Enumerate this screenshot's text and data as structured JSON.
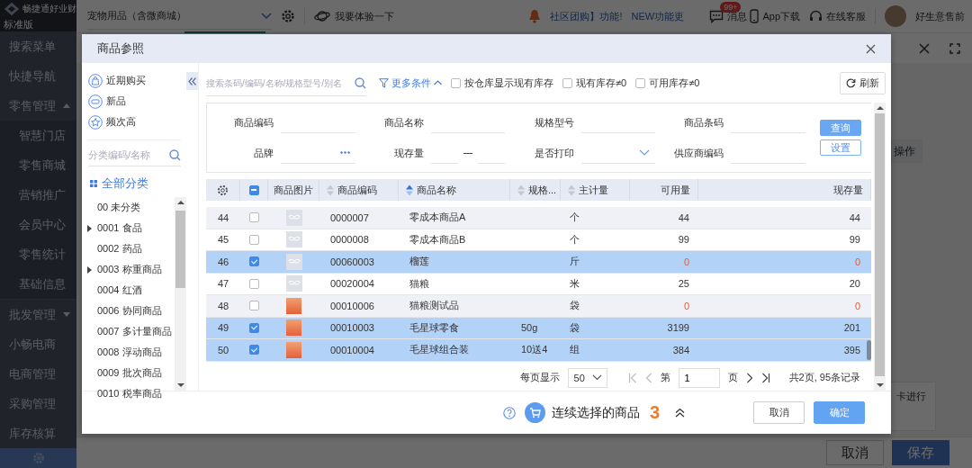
{
  "app": {
    "brand": "畅捷通好业财",
    "edition": "标准版",
    "store": "宠物用品（含微商城）",
    "try_link": "我要体验一下",
    "notices": [
      "社区团购】功能!",
      "NEW功能更"
    ],
    "messages": "消息",
    "message_badge": "99+",
    "app_download": "App下载",
    "support": "在线客服",
    "user": "好生意售前"
  },
  "sidebar": {
    "items": [
      {
        "label": "搜索菜单",
        "kind": "link"
      },
      {
        "label": "快捷导航",
        "kind": "link"
      },
      {
        "label": "零售管理",
        "kind": "group",
        "expanded": true,
        "children": [
          {
            "label": "智慧门店"
          },
          {
            "label": "零售商城"
          },
          {
            "label": "营销推广"
          },
          {
            "label": "会员中心"
          },
          {
            "label": "零售统计"
          },
          {
            "label": "基础信息"
          }
        ]
      },
      {
        "label": "批发管理",
        "kind": "group",
        "expanded": false
      },
      {
        "label": "小畅电商",
        "kind": "link"
      },
      {
        "label": "电商管理",
        "kind": "link"
      },
      {
        "label": "采购管理",
        "kind": "link"
      },
      {
        "label": "库存核算",
        "kind": "link"
      }
    ]
  },
  "page": {
    "action": "操作",
    "note": "卡进行",
    "buttons": [
      {
        "label": "取消",
        "kind": "secondary"
      },
      {
        "label": "保存",
        "kind": "primary"
      }
    ]
  },
  "dialog": {
    "title": "商品参照",
    "quick_filters": [
      {
        "label": "近期购买",
        "kind": "bag"
      },
      {
        "label": "新品",
        "kind": "new"
      },
      {
        "label": "频次高",
        "kind": "star"
      }
    ],
    "category_search": {
      "placeholder": "分类编码/名称"
    },
    "all_categories": "全部分类",
    "categories": [
      {
        "label": "00 未分类",
        "expandable": false
      },
      {
        "label": "0001 食品",
        "expandable": true
      },
      {
        "label": "0002 药品",
        "expandable": false
      },
      {
        "label": "0003 称重商品",
        "expandable": true
      },
      {
        "label": "0004 红酒",
        "expandable": false
      },
      {
        "label": "0006 协同商品",
        "expandable": false
      },
      {
        "label": "0007 多计量商品",
        "expandable": false
      },
      {
        "label": "0008 浮动商品",
        "expandable": false
      },
      {
        "label": "0009 批次商品",
        "expandable": false
      },
      {
        "label": "0010 税率商品",
        "expandable": false
      }
    ],
    "search": {
      "placeholder": "搜索条码/编码/名称/规格型号/别名"
    },
    "more_conditions": "更多条件",
    "options": [
      {
        "label": "按仓库显示现有库存",
        "checked": false
      },
      {
        "label": "现有库存≠0",
        "checked": false
      },
      {
        "label": "可用库存≠0",
        "checked": false
      }
    ],
    "refresh": "刷新",
    "filters": [
      {
        "label": "商品编码",
        "kind": "text"
      },
      {
        "label": "商品名称",
        "kind": "text"
      },
      {
        "label": "规格型号",
        "kind": "text"
      },
      {
        "label": "商品条码",
        "kind": "text"
      },
      {
        "label": "品牌",
        "kind": "picker"
      },
      {
        "label": "现存量",
        "kind": "range"
      },
      {
        "label": "是否打印",
        "kind": "select"
      },
      {
        "label": "供应商编码",
        "kind": "text"
      }
    ],
    "query": "查询",
    "settings": "设置",
    "partially_selected": true,
    "columns": [
      {
        "label": "商品图片",
        "kind": "plain"
      },
      {
        "label": "商品编码",
        "kind": "sortable",
        "sorted": false
      },
      {
        "label": "商品名称",
        "kind": "sortable",
        "sorted": true
      },
      {
        "label": "规格...",
        "kind": "sortable",
        "sorted": false
      },
      {
        "label": "主计量",
        "kind": "sortable",
        "sorted": false
      },
      {
        "label": "可用量",
        "kind": "plain"
      },
      {
        "label": "现存量",
        "kind": "plain"
      }
    ],
    "rows": [
      {
        "no": "44",
        "selected": false,
        "kind": "placeholder",
        "code": "0000007",
        "name": "零成本商品A",
        "spec": "",
        "unit": "个",
        "available": "44",
        "stock": "44",
        "alert": false
      },
      {
        "no": "45",
        "selected": false,
        "kind": "placeholder",
        "code": "0000008",
        "name": "零成本商品B",
        "spec": "",
        "unit": "个",
        "available": "99",
        "stock": "99",
        "alert": false
      },
      {
        "no": "46",
        "selected": true,
        "kind": "placeholder",
        "code": "00060003",
        "name": "榴莲",
        "spec": "",
        "unit": "斤",
        "available": "0",
        "stock": "0",
        "alert": true
      },
      {
        "no": "47",
        "selected": false,
        "kind": "placeholder",
        "code": "00020004",
        "name": "猫粮",
        "spec": "",
        "unit": "米",
        "available": "25",
        "stock": "20",
        "alert": false
      },
      {
        "no": "48",
        "selected": false,
        "kind": "photo",
        "code": "00010006",
        "name": "猫粮测试品",
        "spec": "",
        "unit": "袋",
        "available": "0",
        "stock": "0",
        "alert": true
      },
      {
        "no": "49",
        "selected": true,
        "kind": "photo",
        "code": "00010003",
        "name": "毛星球零食",
        "spec": "50g",
        "unit": "袋",
        "available": "3199",
        "stock": "201",
        "alert": false
      },
      {
        "no": "50",
        "selected": true,
        "kind": "photo",
        "code": "00010004",
        "name": "毛星球组合装",
        "spec": "10送4",
        "unit": "组",
        "available": "384",
        "stock": "395",
        "alert": false
      }
    ],
    "pagination": {
      "per_page_label": "每页显示",
      "per_page": "50",
      "page_prefix": "第",
      "page": "1",
      "page_suffix": "页",
      "total": "共2页, 95条记录"
    },
    "selection_label": "连续选择的商品",
    "selection_count": "3",
    "buttons": [
      {
        "label": "取消",
        "kind": "secondary"
      },
      {
        "label": "确定",
        "kind": "primary"
      }
    ]
  }
}
